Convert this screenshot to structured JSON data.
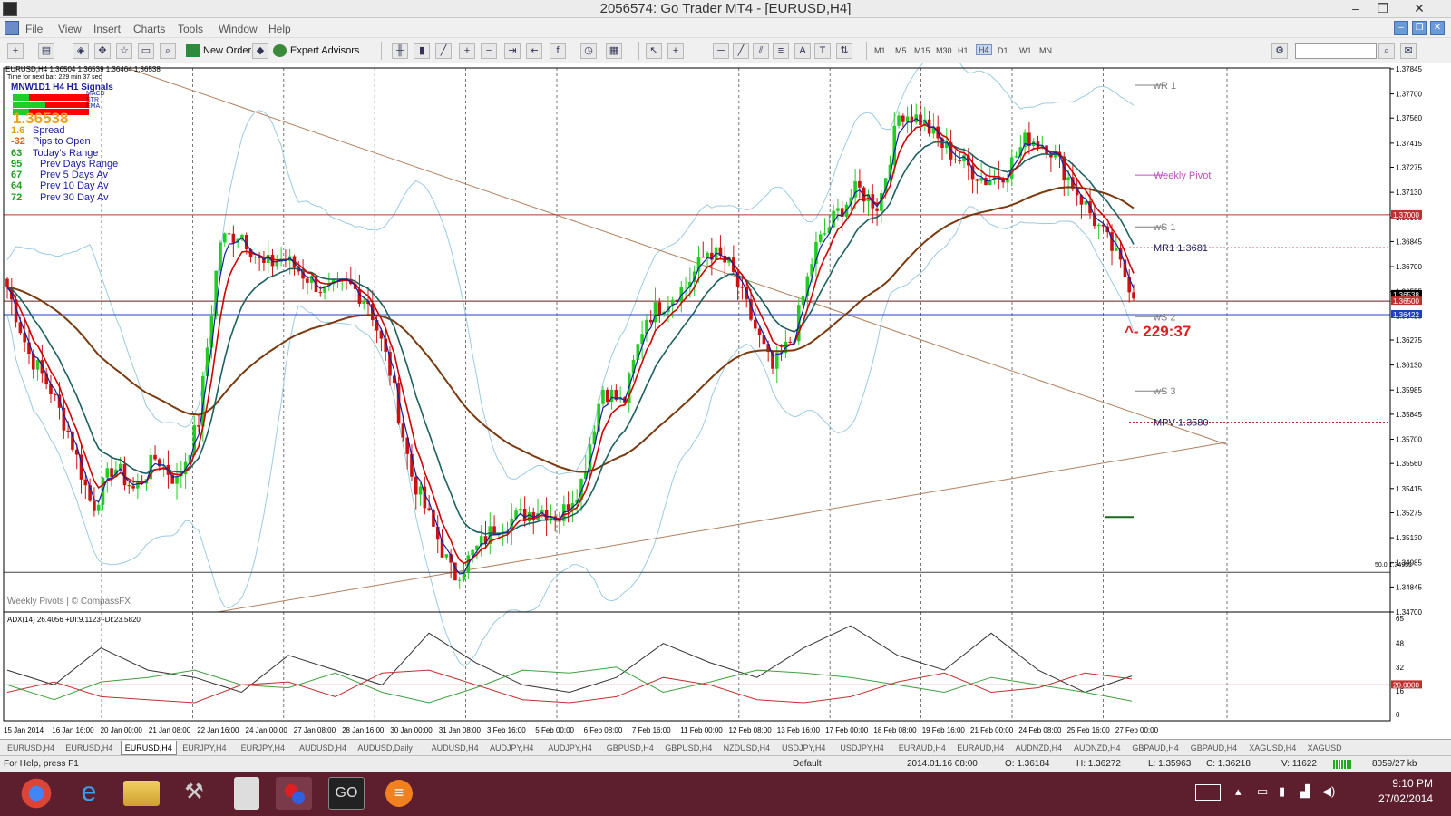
{
  "window": {
    "title": "2056574: Go Trader MT4 - [EURUSD,H4]",
    "minimize": "–",
    "maximize": "❐",
    "close": "✕"
  },
  "menu": [
    "File",
    "View",
    "Insert",
    "Charts",
    "Tools",
    "Window",
    "Help"
  ],
  "toolbar": {
    "new_order": "New Order",
    "expert_advisors": "Expert Advisors",
    "timeframes": [
      "M1",
      "M5",
      "M15",
      "M30",
      "H1",
      "H4",
      "D1",
      "W1",
      "MN"
    ],
    "active_timeframe": "H4"
  },
  "chart_info": {
    "header": "EURUSD,H4  1.36504 1.36539 1.36464 1.36538",
    "next_bar": "Time for next bar: 229 min 37 sec",
    "signals_title": "MNW1D1  H4  H1  Signals",
    "signals_labels": [
      "MACD",
      "STR",
      "EMA"
    ],
    "price": "1.36538",
    "stats": [
      {
        "value": "1.6",
        "label": "Spread",
        "color": "#e6a000"
      },
      {
        "value": "-32",
        "label": "Pips to Open",
        "color": "#e66000"
      },
      {
        "value": "63",
        "label": "Today's Range",
        "color": "#20a020"
      },
      {
        "value": "95",
        "label": "Prev Days Range",
        "color": "#20a020"
      },
      {
        "value": "67",
        "label": "Prev 5 Days Av",
        "color": "#20a020"
      },
      {
        "value": "64",
        "label": "Prev 10 Day Av",
        "color": "#20a020"
      },
      {
        "value": "72",
        "label": "Prev 30 Day Av",
        "color": "#20a020"
      }
    ],
    "watermark": "Weekly Pivots | © CompassFX",
    "countdown": "^- 229:37",
    "fib_label": "50.0 1.34931"
  },
  "pivots": [
    {
      "label": "wR 1",
      "price": 1.3775,
      "color": "#808080"
    },
    {
      "label": "Weekly Pivot",
      "price": 1.3723,
      "color": "#c050c0"
    },
    {
      "label": "wS 1",
      "price": 1.3693,
      "color": "#808080"
    },
    {
      "label": "MR1  1.3681",
      "price": 1.3681,
      "color": "#202060"
    },
    {
      "label": "wS 2",
      "price": 1.3641,
      "color": "#808080"
    },
    {
      "label": "wS 3",
      "price": 1.3598,
      "color": "#808080"
    },
    {
      "label": "MPV  1.3580",
      "price": 1.358,
      "color": "#202060"
    }
  ],
  "chart_data": [
    {
      "type": "candlestick",
      "symbol": "EURUSD",
      "timeframe": "H4",
      "ylim": [
        1.347,
        1.3785
      ],
      "y_ticks": [
        "1.37845",
        "1.37700",
        "1.37560",
        "1.37415",
        "1.37275",
        "1.37130",
        "1.36985",
        "1.36845",
        "1.36700",
        "1.36555",
        "1.36415",
        "1.36275",
        "1.36130",
        "1.35985",
        "1.35845",
        "1.35700",
        "1.35560",
        "1.35415",
        "1.35275",
        "1.35130",
        "1.34985",
        "1.34845",
        "1.34700"
      ],
      "x_ticks": [
        "15 Jan 2014",
        "16 Jan 16:00",
        "20 Jan 00:00",
        "21 Jan 08:00",
        "22 Jan 16:00",
        "24 Jan 00:00",
        "27 Jan 08:00",
        "28 Jan 16:00",
        "30 Jan 00:00",
        "31 Jan 08:00",
        "3 Feb 16:00",
        "5 Feb 00:00",
        "6 Feb 08:00",
        "7 Feb 16:00",
        "11 Feb 00:00",
        "12 Feb 08:00",
        "13 Feb 16:00",
        "17 Feb 00:00",
        "18 Feb 08:00",
        "19 Feb 16:00",
        "21 Feb 00:00",
        "24 Feb 08:00",
        "25 Feb 16:00",
        "27 Feb 00:00"
      ],
      "price_tags": [
        {
          "text": "1.37000",
          "price": 1.37,
          "bg": "#c03030"
        },
        {
          "text": "1.36538",
          "price": 1.36538,
          "bg": "#000000"
        },
        {
          "text": "1.36500",
          "price": 1.365,
          "bg": "#c03030"
        },
        {
          "text": "1.36422",
          "price": 1.36422,
          "bg": "#2040c0"
        }
      ],
      "horizontal_lines": [
        1.37,
        1.365,
        1.36422,
        1.3493
      ],
      "close_path": [
        1.3658,
        1.362,
        1.36,
        1.357,
        1.353,
        1.3555,
        1.354,
        1.356,
        1.3545,
        1.358,
        1.3685,
        1.369,
        1.367,
        1.3675,
        1.3665,
        1.3655,
        1.366,
        1.365,
        1.361,
        1.355,
        1.352,
        1.349,
        1.3505,
        1.352,
        1.3525,
        1.353,
        1.3525,
        1.3545,
        1.36,
        1.359,
        1.364,
        1.365,
        1.366,
        1.368,
        1.367,
        1.364,
        1.361,
        1.363,
        1.368,
        1.37,
        1.3715,
        1.3705,
        1.376,
        1.3755,
        1.374,
        1.373,
        1.372,
        1.3725,
        1.3745,
        1.374,
        1.372,
        1.37,
        1.368,
        1.3655
      ],
      "series": [
        {
          "name": "EMA fast",
          "color": "#d00000"
        },
        {
          "name": "EMA slow",
          "color": "#1c6060"
        },
        {
          "name": "SMA 200",
          "color": "#7a3a10"
        },
        {
          "name": "Bollinger",
          "color": "#9ccbe0"
        }
      ]
    },
    {
      "type": "line",
      "title": "ADX(14) 26.4056 +DI:9.1123 -DI:23.5820",
      "ylim": [
        0,
        65
      ],
      "y_ticks": [
        "65",
        "48",
        "32",
        "20.0000",
        "16",
        "0"
      ],
      "series": [
        {
          "name": "ADX",
          "color": "#333333",
          "values": [
            30,
            20,
            45,
            30,
            25,
            15,
            40,
            30,
            20,
            55,
            35,
            20,
            15,
            25,
            48,
            35,
            25,
            45,
            60,
            40,
            30,
            55,
            30,
            15,
            26
          ]
        },
        {
          "name": "+DI",
          "color": "#40a040",
          "values": [
            20,
            10,
            22,
            25,
            30,
            20,
            18,
            28,
            15,
            8,
            18,
            30,
            28,
            32,
            15,
            22,
            30,
            28,
            25,
            20,
            15,
            25,
            20,
            15,
            9
          ]
        },
        {
          "name": "-DI",
          "color": "#c03030",
          "values": [
            15,
            22,
            12,
            10,
            8,
            20,
            22,
            12,
            28,
            30,
            20,
            10,
            8,
            12,
            25,
            20,
            10,
            8,
            12,
            22,
            28,
            15,
            18,
            28,
            24
          ]
        }
      ]
    }
  ],
  "tabs": [
    "EURUSD,H4",
    "EURUSD,H4",
    "EURUSD,H4",
    "EURJPY,H4",
    "EURJPY,H4",
    "AUDUSD,H4",
    "AUDUSD,Daily",
    "AUDUSD,H4",
    "AUDJPY,H4",
    "AUDJPY,H4",
    "GBPUSD,H4",
    "GBPUSD,H4",
    "NZDUSD,H4",
    "USDJPY,H4",
    "USDJPY,H4",
    "EURAUD,H4",
    "EURAUD,H4",
    "AUDNZD,H4",
    "AUDNZD,H4",
    "GBPAUD,H4",
    "GBPAUD,H4",
    "XAGUSD,H4",
    "XAGUSD"
  ],
  "active_tab": 2,
  "status": {
    "help": "For Help, press F1",
    "profile": "Default",
    "time": "2014.01.16 08:00",
    "open": "O: 1.36184",
    "high": "H: 1.36272",
    "low": "L: 1.35963",
    "close": "C: 1.36218",
    "volume": "V: 11622",
    "traffic": "8059/27 kb"
  },
  "taskbar": {
    "time": "9:10 PM",
    "date": "27/02/2014",
    "apps": [
      "chrome",
      "internet-explorer",
      "file-explorer",
      "tools",
      "calculator",
      "media",
      "go-trader",
      "sublime"
    ]
  },
  "colors": {
    "taskbar": "#5d1f2e",
    "bull_candle": "#22cc22",
    "bear_candle": "#cc1111"
  }
}
